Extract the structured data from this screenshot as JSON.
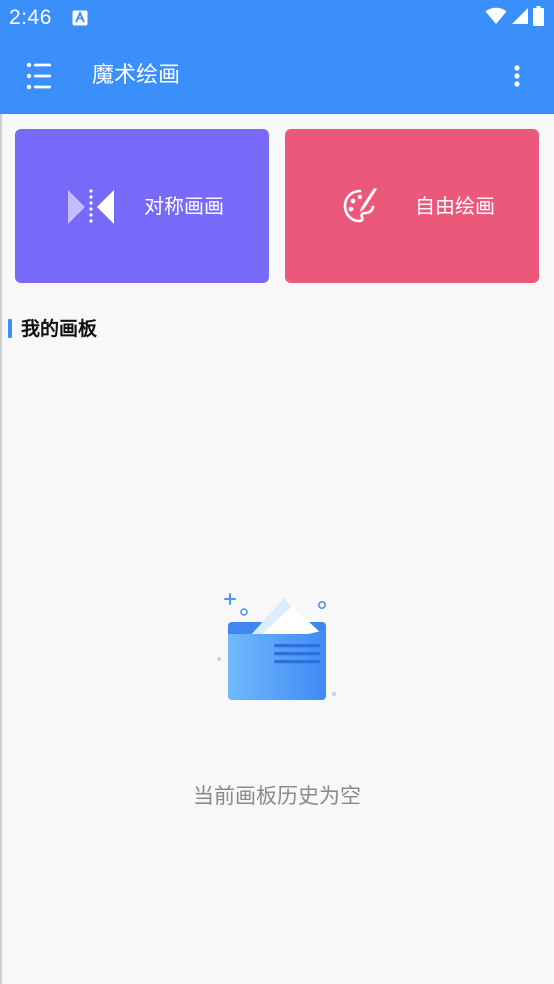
{
  "status_bar": {
    "time": "2:46",
    "notification_icon": "app-notification-icon",
    "wifi_icon": "wifi-icon",
    "signal_icon": "cell-signal-icon",
    "battery_icon": "battery-icon"
  },
  "app_bar": {
    "title": "魔术绘画",
    "menu_icon": "list-menu-icon",
    "more_icon": "more-vert-icon",
    "color": "#3b8ffb"
  },
  "cards": {
    "symmetric": {
      "label": "对称画画",
      "icon": "mirror-symmetry-icon",
      "color": "#776af8"
    },
    "free": {
      "label": "自由绘画",
      "icon": "palette-brush-icon",
      "color": "#ec587a"
    }
  },
  "section": {
    "title": "我的画板"
  },
  "empty_state": {
    "icon": "empty-folder-icon",
    "text": "当前画板历史为空"
  }
}
